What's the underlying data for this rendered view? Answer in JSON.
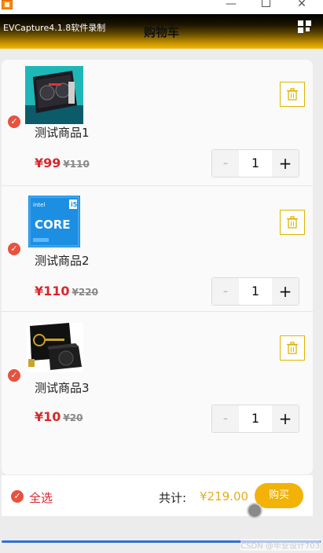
{
  "window": {
    "minimize_glyph": "—",
    "close_glyph": "✕"
  },
  "header": {
    "app_label": "EVCapture4.1.8软件录制",
    "title": "购物车",
    "menu_icon": "grid-menu-icon"
  },
  "cart": {
    "items": [
      {
        "name": "测试商品1",
        "price": "¥99",
        "original_price": "¥110",
        "quantity": "1",
        "checked": true,
        "image": "graphics-card"
      },
      {
        "name": "测试商品2",
        "price": "¥110",
        "original_price": "¥220",
        "quantity": "1",
        "checked": true,
        "image": "cpu-box"
      },
      {
        "name": "测试商品3",
        "price": "¥10",
        "original_price": "¥20",
        "quantity": "1",
        "checked": true,
        "image": "power-supply"
      }
    ],
    "stepper": {
      "minus": "-",
      "plus": "+"
    }
  },
  "footer": {
    "select_all_label": "全选",
    "total_label": "共计:",
    "total_value": "¥219.00",
    "buy_label": "购买"
  },
  "watermark": "CSDN @毕业设计703",
  "colors": {
    "accent_red": "#d8262c",
    "check_red": "#e8513d",
    "gold": "#f2b306",
    "total_gold": "#e5ad1b"
  }
}
